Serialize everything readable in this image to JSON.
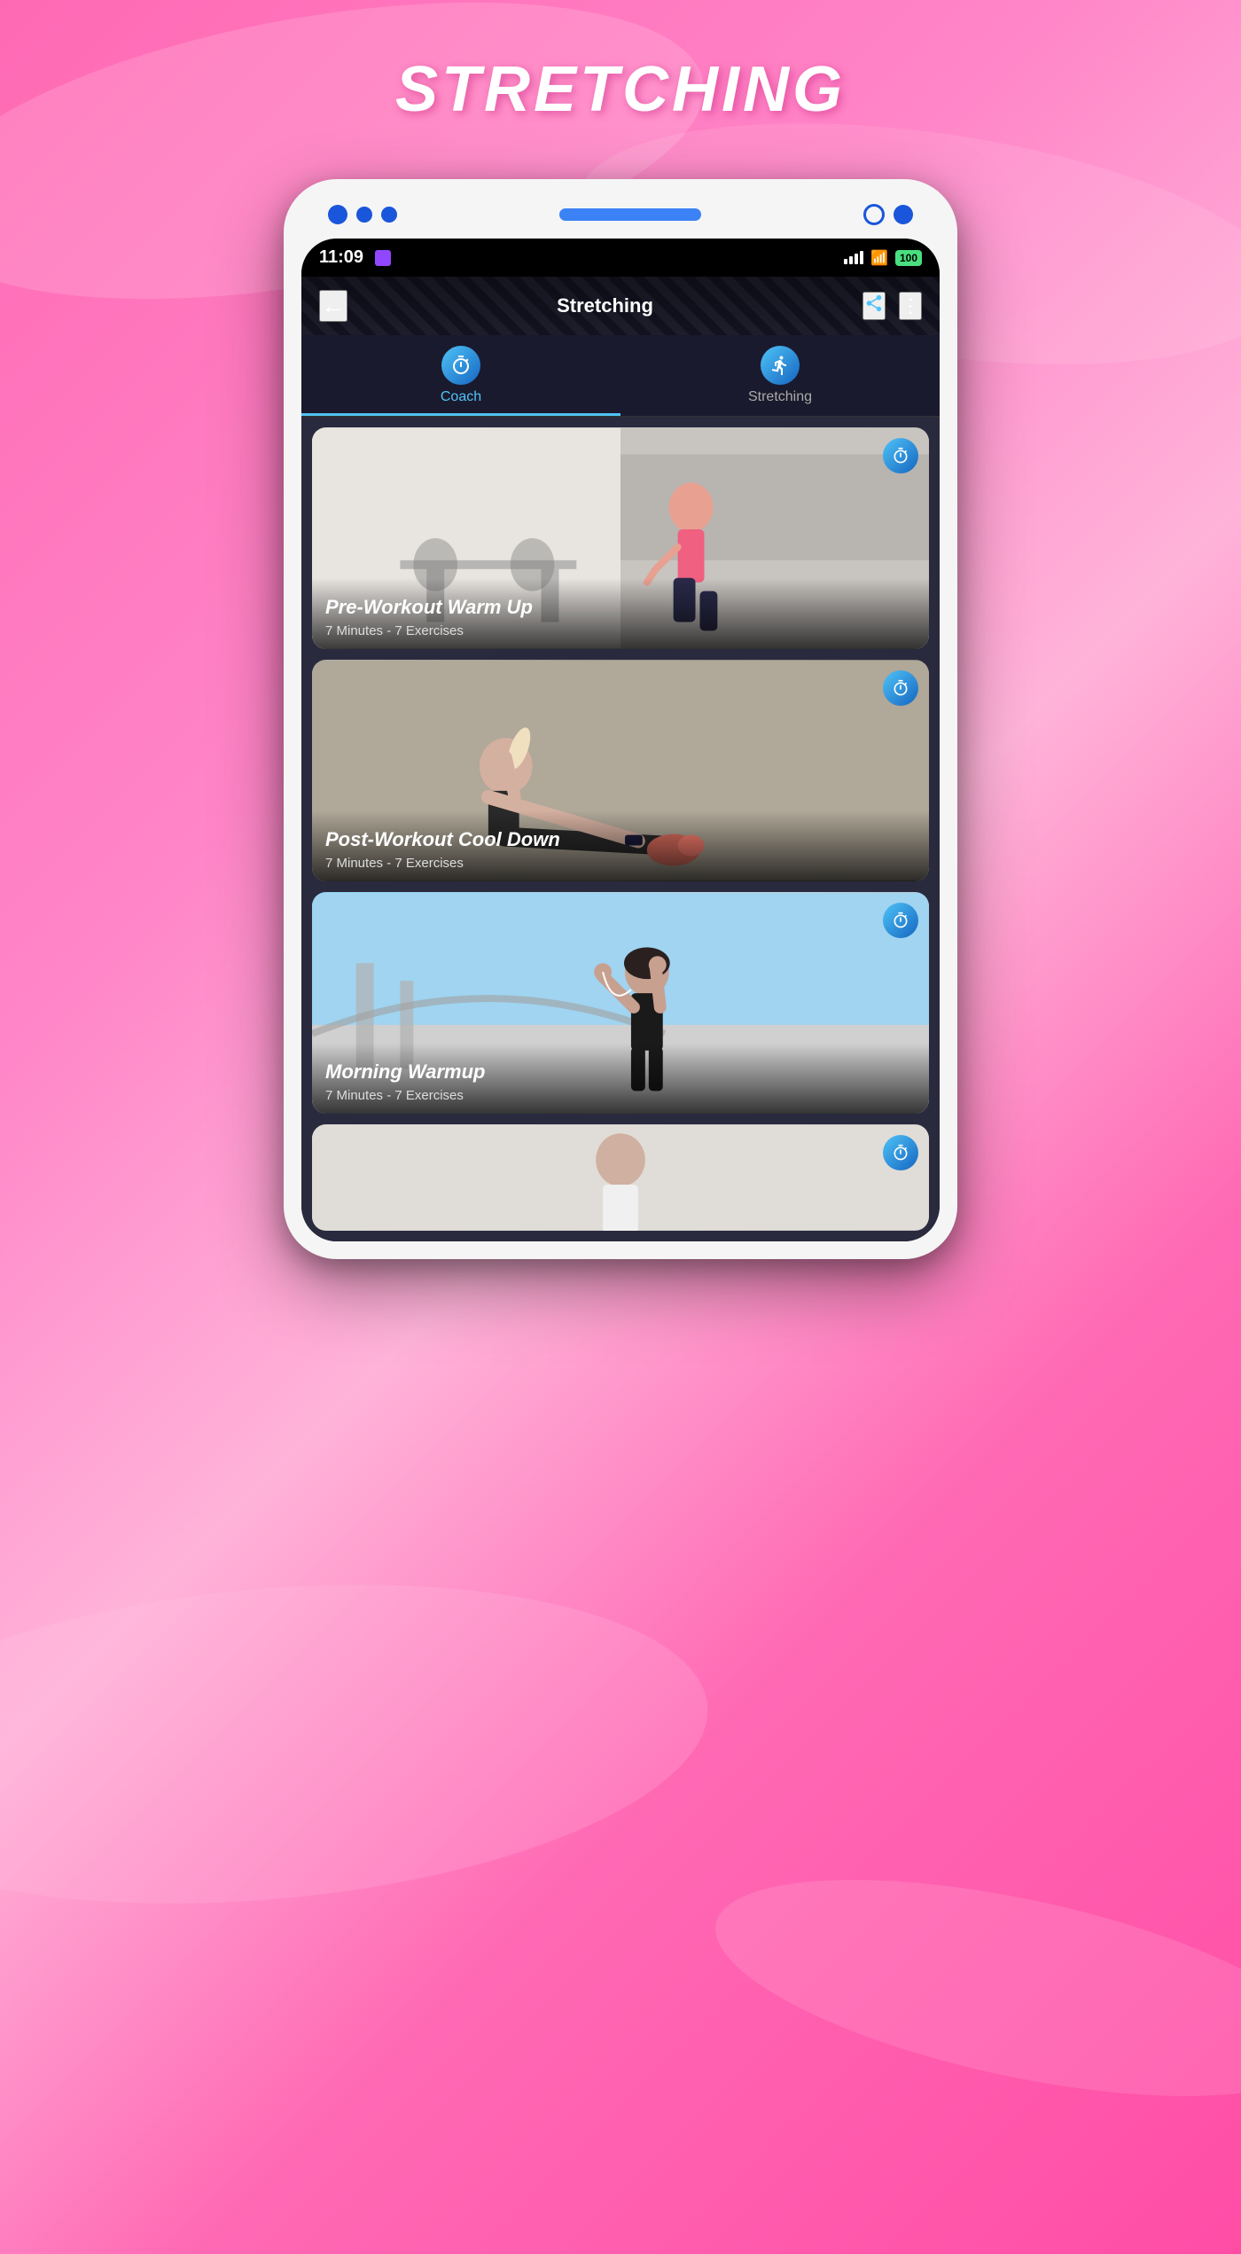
{
  "page": {
    "title": "STRETCHING",
    "background_colors": [
      "#ff69b4",
      "#ff85c8",
      "#ffb3d9"
    ]
  },
  "phone": {
    "status_bar": {
      "time": "11:09",
      "battery": "100",
      "battery_color": "#4ade80"
    },
    "header": {
      "title": "Stretching",
      "back_icon": "←",
      "share_icon": "share",
      "more_icon": "⋮"
    },
    "tabs": [
      {
        "id": "coach",
        "label": "Coach",
        "icon": "⏱",
        "active": true
      },
      {
        "id": "stretching",
        "label": "Stretching",
        "icon": "💪",
        "active": false
      }
    ],
    "workout_cards": [
      {
        "id": "pre-workout",
        "title": "Pre-Workout Warm Up",
        "subtitle": "7 Minutes - 7 Exercises",
        "has_timer": true,
        "theme": "light"
      },
      {
        "id": "post-workout",
        "title": "Post-Workout Cool Down",
        "subtitle": "7 Minutes - 7 Exercises",
        "has_timer": true,
        "theme": "dark"
      },
      {
        "id": "morning-warmup",
        "title": "Morning Warmup",
        "subtitle": "7 Minutes - 7 Exercises",
        "has_timer": true,
        "theme": "sky"
      },
      {
        "id": "card-4",
        "title": "",
        "subtitle": "",
        "has_timer": true,
        "theme": "light2",
        "partial": true
      }
    ]
  },
  "icons": {
    "back": "←",
    "share": "⬆",
    "more": "⋮",
    "timer": "⏱",
    "muscle": "💪"
  }
}
